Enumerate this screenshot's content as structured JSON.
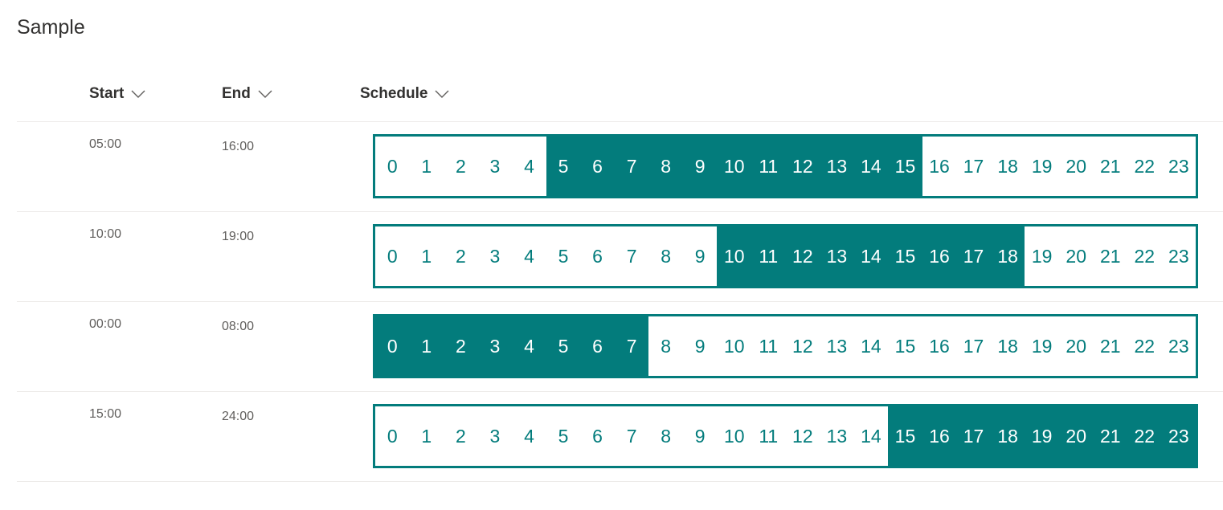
{
  "title": "Sample",
  "columns": {
    "start": "Start",
    "end": "End",
    "schedule": "Schedule"
  },
  "hours": [
    "0",
    "1",
    "2",
    "3",
    "4",
    "5",
    "6",
    "7",
    "8",
    "9",
    "10",
    "11",
    "12",
    "13",
    "14",
    "15",
    "16",
    "17",
    "18",
    "19",
    "20",
    "21",
    "22",
    "23"
  ],
  "rows": [
    {
      "start": "05:00",
      "end": "16:00",
      "active_from": 5,
      "active_to": 15
    },
    {
      "start": "10:00",
      "end": "19:00",
      "active_from": 10,
      "active_to": 18
    },
    {
      "start": "00:00",
      "end": "08:00",
      "active_from": 0,
      "active_to": 7
    },
    {
      "start": "15:00",
      "end": "24:00",
      "active_from": 15,
      "active_to": 23
    }
  ],
  "colors": {
    "accent": "#037c7c",
    "text": "#323130",
    "muted": "#605e5c",
    "divider": "#edebe9"
  },
  "icons": {
    "sort": "chevron-down-icon"
  }
}
